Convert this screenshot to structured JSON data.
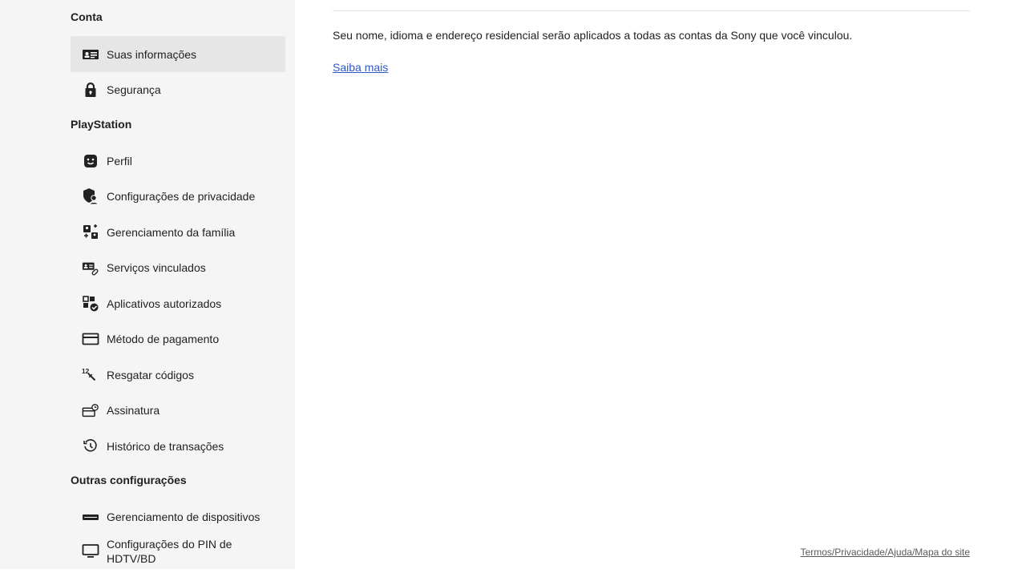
{
  "sidebar": {
    "sections": [
      {
        "title": "Conta"
      },
      {
        "title": "PlayStation"
      },
      {
        "title": "Outras configurações"
      }
    ],
    "items": [
      {
        "label": "Suas informações",
        "icon": "id-card-icon"
      },
      {
        "label": "Segurança",
        "icon": "lock-icon"
      },
      {
        "label": "Perfil",
        "icon": "face-icon"
      },
      {
        "label": "Configurações de privacidade",
        "icon": "shield-user-icon"
      },
      {
        "label": "Gerenciamento da família",
        "icon": "family-icon"
      },
      {
        "label": "Serviços vinculados",
        "icon": "linked-card-icon"
      },
      {
        "label": "Aplicativos autorizados",
        "icon": "authorized-apps-icon"
      },
      {
        "label": "Método de pagamento",
        "icon": "credit-card-icon"
      },
      {
        "label": "Resgatar códigos",
        "icon": "redeem-code-icon"
      },
      {
        "label": "Assinatura",
        "icon": "subscription-icon"
      },
      {
        "label": "Histórico de transações",
        "icon": "history-icon"
      },
      {
        "label": "Gerenciamento de dispositivos",
        "icon": "device-icon"
      },
      {
        "label": "Configurações do PIN de HDTV/BD",
        "icon": "monitor-icon"
      }
    ]
  },
  "main": {
    "description": "Seu nome, idioma e endereço residencial serão aplicados a todas as contas da Sony que você vinculou.",
    "learn_more": "Saiba mais"
  },
  "footer": {
    "links": "Termos/Privacidade/Ajuda/Mapa do site"
  },
  "colors": {
    "sidebar_bg": "#f5f5f5",
    "active_bg": "#e6e6e6",
    "link": "#2f57c9"
  }
}
